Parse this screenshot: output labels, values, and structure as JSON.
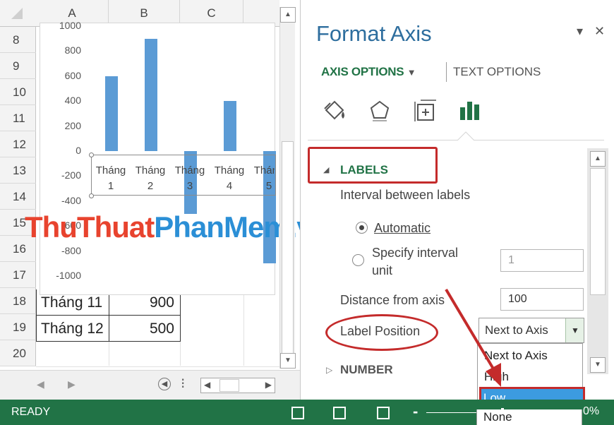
{
  "sheet": {
    "columns": [
      "A",
      "B",
      "C"
    ],
    "rows": [
      "8",
      "9",
      "10",
      "11",
      "12",
      "13",
      "14",
      "15",
      "16",
      "17",
      "18",
      "19",
      "20"
    ],
    "cells": [
      {
        "label": "Tháng 11",
        "value": "900"
      },
      {
        "label": "Tháng 12",
        "value": "500"
      }
    ]
  },
  "chart_data": {
    "type": "bar",
    "categories": [
      "Tháng 1",
      "Tháng 2",
      "Tháng 3",
      "Tháng 4",
      "Tháng 5"
    ],
    "values": [
      600,
      900,
      -500,
      400,
      -900
    ],
    "ylim": [
      -1000,
      1000
    ],
    "yticks": [
      "1000",
      "800",
      "600",
      "400",
      "200",
      "0",
      "-200",
      "-400",
      "-600",
      "-800",
      "-1000"
    ],
    "color": "#5b9bd5",
    "grid": false
  },
  "watermark": {
    "part1": "ThuThuat",
    "part2": "PhanMem",
    "part3": ".vn"
  },
  "pane": {
    "title": "Format Axis",
    "tab_axis": "AXIS OPTIONS",
    "tab_text": "TEXT OPTIONS",
    "icons": [
      "fill-line-icon",
      "effects-icon",
      "size-properties-icon",
      "axis-options-icon"
    ],
    "section": "LABELS",
    "interval_label": "Interval between labels",
    "automatic": "Automatic",
    "specify_line1": "Specify interval",
    "specify_line2": "unit",
    "specify_value": "1",
    "distance_label": "Distance from axis",
    "distance_value": "100",
    "position_label": "Label Position",
    "position_value": "Next to Axis",
    "number_section": "NUMBER",
    "dropdown": [
      "Next to Axis",
      "High",
      "Low",
      "None"
    ]
  },
  "status": {
    "ready": "READY",
    "zoom": "0%"
  },
  "colors": {
    "excel_green": "#217346",
    "bar_blue": "#5b9bd5",
    "highlight_red": "#c42b2b",
    "select_blue": "#3c9be0"
  }
}
